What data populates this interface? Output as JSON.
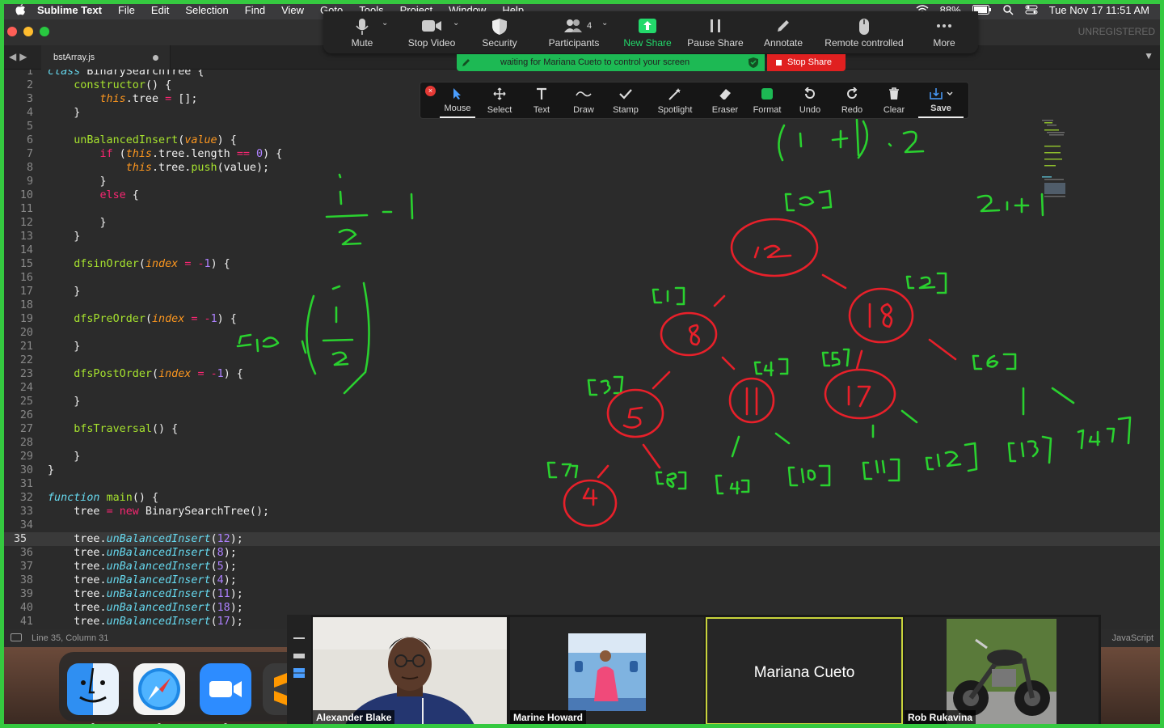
{
  "menubar": {
    "app": "Sublime Text",
    "items": [
      "File",
      "Edit",
      "Selection",
      "Find",
      "View",
      "Goto",
      "Tools",
      "Project",
      "Window",
      "Help"
    ],
    "battery": "88%",
    "datetime": "Tue Nov 17  11:51 AM"
  },
  "window": {
    "unregistered": "UNREGISTERED",
    "tab": "bstArray.js",
    "status": "Line 35, Column 31",
    "syntax": "JavaScript",
    "current_line": 35
  },
  "code_lines": [
    [
      [
        "cl",
        "class "
      ],
      [
        "t",
        "BinarySearchTree {"
      ]
    ],
    [
      [
        "t",
        "    "
      ],
      [
        "fn",
        "constructor"
      ],
      [
        "t",
        "() {"
      ]
    ],
    [
      [
        "t",
        "        "
      ],
      [
        "th",
        "this"
      ],
      [
        "t",
        ".tree "
      ],
      [
        "kw",
        "="
      ],
      [
        "t",
        " [];"
      ]
    ],
    [
      [
        "t",
        "    }"
      ]
    ],
    [
      [
        "t",
        ""
      ]
    ],
    [
      [
        "t",
        "    "
      ],
      [
        "fn",
        "unBalancedInsert"
      ],
      [
        "t",
        "("
      ],
      [
        "pr",
        "value"
      ],
      [
        "t",
        ") {"
      ]
    ],
    [
      [
        "t",
        "        "
      ],
      [
        "kw",
        "if"
      ],
      [
        "t",
        " ("
      ],
      [
        "th",
        "this"
      ],
      [
        "t",
        ".tree.length "
      ],
      [
        "kw",
        "=="
      ],
      [
        "t",
        " "
      ],
      [
        "nm",
        "0"
      ],
      [
        "t",
        ") {"
      ]
    ],
    [
      [
        "t",
        "            "
      ],
      [
        "th",
        "this"
      ],
      [
        "t",
        ".tree."
      ],
      [
        "fn",
        "push"
      ],
      [
        "t",
        "(value);"
      ]
    ],
    [
      [
        "t",
        "        }"
      ]
    ],
    [
      [
        "t",
        "        "
      ],
      [
        "kw",
        "else"
      ],
      [
        "t",
        " {"
      ]
    ],
    [
      [
        "t",
        ""
      ]
    ],
    [
      [
        "t",
        "        }"
      ]
    ],
    [
      [
        "t",
        "    }"
      ]
    ],
    [
      [
        "t",
        ""
      ]
    ],
    [
      [
        "t",
        "    "
      ],
      [
        "fn",
        "dfsinOrder"
      ],
      [
        "t",
        "("
      ],
      [
        "pr",
        "index"
      ],
      [
        "t",
        " "
      ],
      [
        "kw",
        "="
      ],
      [
        "t",
        " "
      ],
      [
        "kw",
        "-"
      ],
      [
        "nm",
        "1"
      ],
      [
        "t",
        ") {"
      ]
    ],
    [
      [
        "t",
        ""
      ]
    ],
    [
      [
        "t",
        "    }"
      ]
    ],
    [
      [
        "t",
        ""
      ]
    ],
    [
      [
        "t",
        "    "
      ],
      [
        "fn",
        "dfsPreOrder"
      ],
      [
        "t",
        "("
      ],
      [
        "pr",
        "index"
      ],
      [
        "t",
        " "
      ],
      [
        "kw",
        "="
      ],
      [
        "t",
        " "
      ],
      [
        "kw",
        "-"
      ],
      [
        "nm",
        "1"
      ],
      [
        "t",
        ") {"
      ]
    ],
    [
      [
        "t",
        ""
      ]
    ],
    [
      [
        "t",
        "    }"
      ]
    ],
    [
      [
        "t",
        ""
      ]
    ],
    [
      [
        "t",
        "    "
      ],
      [
        "fn",
        "dfsPostOrder"
      ],
      [
        "t",
        "("
      ],
      [
        "pr",
        "index"
      ],
      [
        "t",
        " "
      ],
      [
        "kw",
        "="
      ],
      [
        "t",
        " "
      ],
      [
        "kw",
        "-"
      ],
      [
        "nm",
        "1"
      ],
      [
        "t",
        ") {"
      ]
    ],
    [
      [
        "t",
        ""
      ]
    ],
    [
      [
        "t",
        "    }"
      ]
    ],
    [
      [
        "t",
        ""
      ]
    ],
    [
      [
        "t",
        "    "
      ],
      [
        "fn",
        "bfsTraversal"
      ],
      [
        "t",
        "() {"
      ]
    ],
    [
      [
        "t",
        ""
      ]
    ],
    [
      [
        "t",
        "    }"
      ]
    ],
    [
      [
        "t",
        "}"
      ]
    ],
    [
      [
        "t",
        ""
      ]
    ],
    [
      [
        "st",
        "function"
      ],
      [
        "t",
        " "
      ],
      [
        "fn",
        "main"
      ],
      [
        "t",
        "() {"
      ]
    ],
    [
      [
        "t",
        "    tree "
      ],
      [
        "kw",
        "="
      ],
      [
        "t",
        " "
      ],
      [
        "kw",
        "new"
      ],
      [
        "t",
        " BinarySearchTree();"
      ]
    ],
    [
      [
        "t",
        ""
      ]
    ],
    [
      [
        "t",
        "    tree."
      ],
      [
        "st",
        "unBalancedInsert"
      ],
      [
        "t",
        "("
      ],
      [
        "nm",
        "12"
      ],
      [
        "t",
        ");"
      ]
    ],
    [
      [
        "t",
        "    tree."
      ],
      [
        "st",
        "unBalancedInsert"
      ],
      [
        "t",
        "("
      ],
      [
        "nm",
        "8"
      ],
      [
        "t",
        ");"
      ]
    ],
    [
      [
        "t",
        "    tree."
      ],
      [
        "st",
        "unBalancedInsert"
      ],
      [
        "t",
        "("
      ],
      [
        "nm",
        "5"
      ],
      [
        "t",
        ");"
      ]
    ],
    [
      [
        "t",
        "    tree."
      ],
      [
        "st",
        "unBalancedInsert"
      ],
      [
        "t",
        "("
      ],
      [
        "nm",
        "4"
      ],
      [
        "t",
        ");"
      ]
    ],
    [
      [
        "t",
        "    tree."
      ],
      [
        "st",
        "unBalancedInsert"
      ],
      [
        "t",
        "("
      ],
      [
        "nm",
        "11"
      ],
      [
        "t",
        ");"
      ]
    ],
    [
      [
        "t",
        "    tree."
      ],
      [
        "st",
        "unBalancedInsert"
      ],
      [
        "t",
        "("
      ],
      [
        "nm",
        "18"
      ],
      [
        "t",
        ");"
      ]
    ],
    [
      [
        "t",
        "    tree."
      ],
      [
        "st",
        "unBalancedInsert"
      ],
      [
        "t",
        "("
      ],
      [
        "nm",
        "17"
      ],
      [
        "t",
        ");"
      ]
    ]
  ],
  "zoom_toolbar": {
    "participants_count": "4",
    "buttons": [
      {
        "label": "Mute",
        "icon": "microphone-icon"
      },
      {
        "label": "Stop Video",
        "icon": "video-camera-icon"
      },
      {
        "label": "Security",
        "icon": "shield-icon"
      },
      {
        "label": "Participants",
        "icon": "people-icon"
      },
      {
        "label": "New Share",
        "icon": "share-arrow-icon"
      },
      {
        "label": "Pause Share",
        "icon": "pause-icon"
      },
      {
        "label": "Annotate",
        "icon": "pencil-icon"
      },
      {
        "label": "Remote controlled",
        "icon": "mouse-icon"
      },
      {
        "label": "More",
        "icon": "ellipsis-icon"
      }
    ],
    "banner": "waiting for Mariana Cueto to control your screen",
    "stop_share": "Stop Share"
  },
  "annotate_toolbar": {
    "tools": [
      {
        "label": "Mouse",
        "icon": "cursor-icon"
      },
      {
        "label": "Select",
        "icon": "move-icon"
      },
      {
        "label": "Text",
        "icon": "text-icon"
      },
      {
        "label": "Draw",
        "icon": "squiggle-icon"
      },
      {
        "label": "Stamp",
        "icon": "checkmark-icon"
      },
      {
        "label": "Spotlight",
        "icon": "wand-icon"
      },
      {
        "label": "Eraser",
        "icon": "eraser-icon"
      },
      {
        "label": "Format",
        "icon": "color-swatch-icon"
      },
      {
        "label": "Undo",
        "icon": "undo-icon"
      },
      {
        "label": "Redo",
        "icon": "redo-icon"
      },
      {
        "label": "Clear",
        "icon": "trash-icon"
      },
      {
        "label": "Save",
        "icon": "save-icon"
      }
    ],
    "format_color": "#1db954"
  },
  "participants": [
    {
      "name": "Alexander Blake",
      "type": "video"
    },
    {
      "name": "Marine Howard",
      "type": "photo"
    },
    {
      "name": "Mariana Cueto",
      "type": "name-only",
      "speaking": true
    },
    {
      "name": "Rob Rukavina",
      "type": "photo"
    }
  ],
  "colors": {
    "ink_red": "#e8202a",
    "ink_green": "#2ad12f",
    "share_green": "#35c940"
  }
}
